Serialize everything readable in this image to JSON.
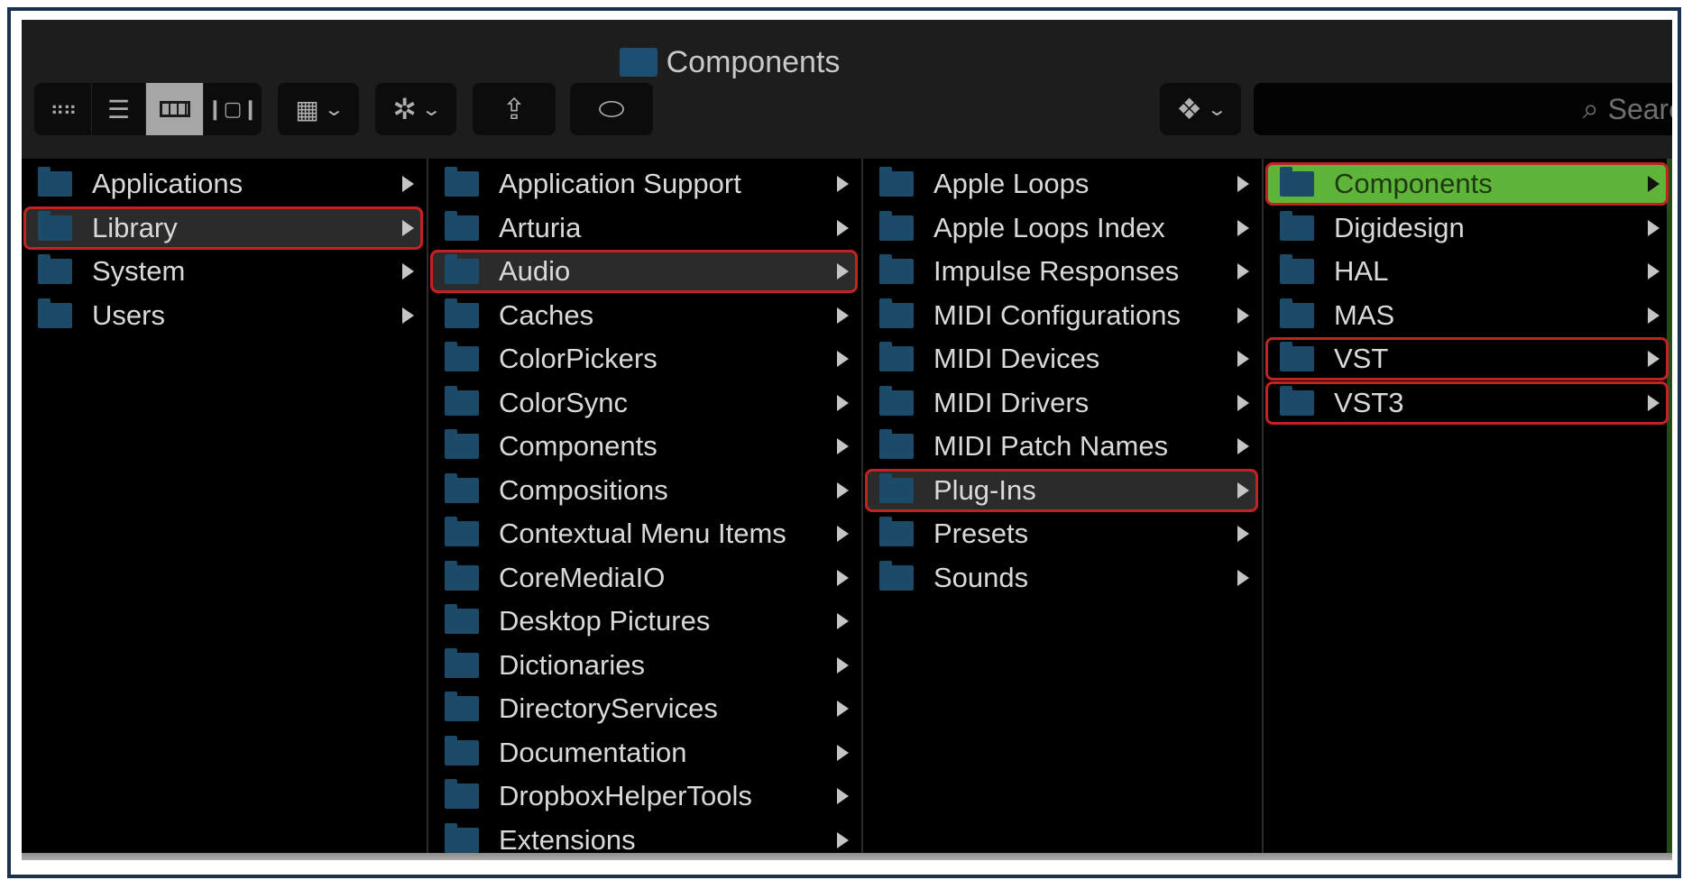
{
  "window": {
    "title": "Components",
    "title_icon": "folder-icon"
  },
  "toolbar": {
    "view_modes": [
      {
        "name": "icon-view",
        "glyph": "▦",
        "active": false
      },
      {
        "name": "list-view",
        "glyph": "☰",
        "active": false
      },
      {
        "name": "column-view",
        "glyph": "▥",
        "active": true
      },
      {
        "name": "cover-flow-view",
        "glyph": "▯",
        "active": false
      }
    ],
    "arrange_glyph": "▦",
    "action_glyph": "✲",
    "share_glyph": "⇪",
    "tag_glyph": "⬭",
    "dropbox_glyph": "❖",
    "chevron_glyph": "⌄",
    "search_icon": "⌕",
    "search_placeholder": "Search"
  },
  "columns": [
    {
      "items": [
        {
          "label": "Applications",
          "selected": false,
          "marked": false
        },
        {
          "label": "Library",
          "selected": true,
          "marked": true
        },
        {
          "label": "System",
          "selected": false,
          "marked": false
        },
        {
          "label": "Users",
          "selected": false,
          "marked": false
        }
      ]
    },
    {
      "items": [
        {
          "label": "Application Support",
          "selected": false,
          "marked": false
        },
        {
          "label": "Arturia",
          "selected": false,
          "marked": false
        },
        {
          "label": "Audio",
          "selected": true,
          "marked": true
        },
        {
          "label": "Caches",
          "selected": false,
          "marked": false
        },
        {
          "label": "ColorPickers",
          "selected": false,
          "marked": false
        },
        {
          "label": "ColorSync",
          "selected": false,
          "marked": false
        },
        {
          "label": "Components",
          "selected": false,
          "marked": false
        },
        {
          "label": "Compositions",
          "selected": false,
          "marked": false
        },
        {
          "label": "Contextual Menu Items",
          "selected": false,
          "marked": false
        },
        {
          "label": "CoreMediaIO",
          "selected": false,
          "marked": false
        },
        {
          "label": "Desktop Pictures",
          "selected": false,
          "marked": false
        },
        {
          "label": "Dictionaries",
          "selected": false,
          "marked": false
        },
        {
          "label": "DirectoryServices",
          "selected": false,
          "marked": false
        },
        {
          "label": "Documentation",
          "selected": false,
          "marked": false
        },
        {
          "label": "DropboxHelperTools",
          "selected": false,
          "marked": false
        },
        {
          "label": "Extensions",
          "selected": false,
          "marked": false
        }
      ]
    },
    {
      "items": [
        {
          "label": "Apple Loops",
          "selected": false,
          "marked": false
        },
        {
          "label": "Apple Loops Index",
          "selected": false,
          "marked": false
        },
        {
          "label": "Impulse Responses",
          "selected": false,
          "marked": false
        },
        {
          "label": "MIDI Configurations",
          "selected": false,
          "marked": false
        },
        {
          "label": "MIDI Devices",
          "selected": false,
          "marked": false
        },
        {
          "label": "MIDI Drivers",
          "selected": false,
          "marked": false
        },
        {
          "label": "MIDI Patch Names",
          "selected": false,
          "marked": false
        },
        {
          "label": "Plug-Ins",
          "selected": true,
          "marked": true
        },
        {
          "label": "Presets",
          "selected": false,
          "marked": false
        },
        {
          "label": "Sounds",
          "selected": false,
          "marked": false
        }
      ]
    },
    {
      "items": [
        {
          "label": "Components",
          "selected": true,
          "marked": true,
          "highlight": "green"
        },
        {
          "label": "Digidesign",
          "selected": false,
          "marked": false
        },
        {
          "label": "HAL",
          "selected": false,
          "marked": false
        },
        {
          "label": "MAS",
          "selected": false,
          "marked": false
        },
        {
          "label": "VST",
          "selected": false,
          "marked": true
        },
        {
          "label": "VST3",
          "selected": false,
          "marked": true
        }
      ]
    }
  ],
  "colors": {
    "highlight_green": "#5fb43a",
    "annotation_red": "#c42222",
    "folder_blue": "#1b4b68",
    "frame_navy": "#1b3150"
  }
}
